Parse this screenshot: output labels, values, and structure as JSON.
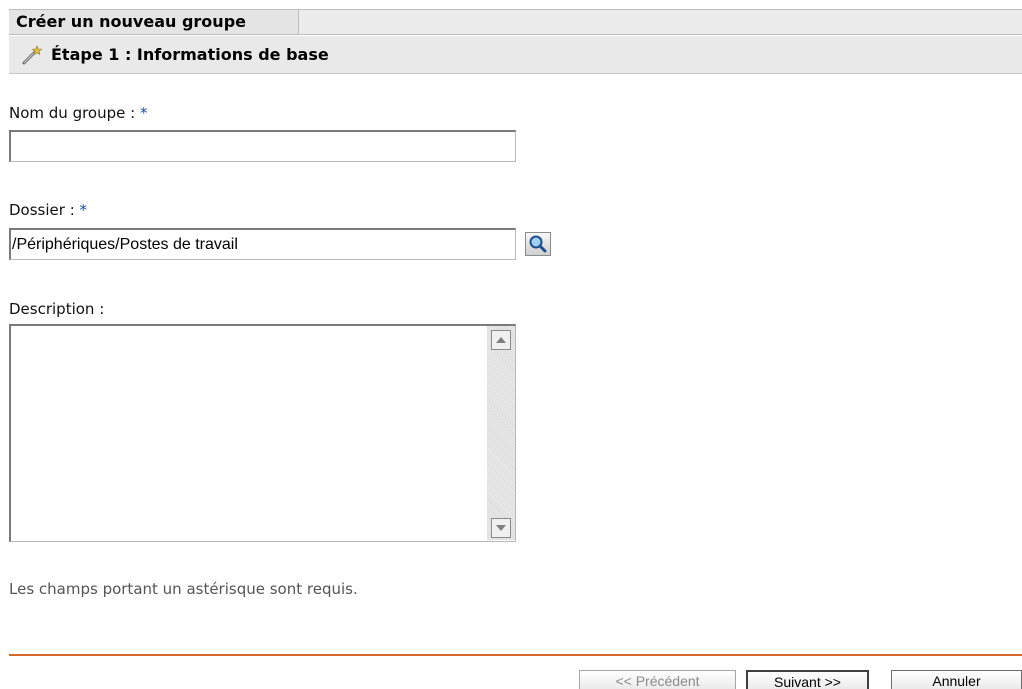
{
  "wizard": {
    "title": "Créer un nouveau groupe",
    "step_title": "Étape 1 : Informations de base",
    "step_icon": "wand-icon"
  },
  "fields": {
    "group_name": {
      "label": "Nom du groupe : ",
      "required_mark": "*",
      "value": ""
    },
    "folder": {
      "label": "Dossier : ",
      "required_mark": "*",
      "value": "/Périphériques/Postes de travail",
      "browse_icon": "magnifier-icon"
    },
    "description": {
      "label": "Description :",
      "value": ""
    }
  },
  "required_note": "Les champs portant un astérisque sont requis.",
  "buttons": {
    "previous": "<< Précédent",
    "next": "Suivant >>",
    "cancel": "Annuler"
  },
  "colors": {
    "divider": "#d2692a",
    "required_asterisk": "#1a4fa0"
  }
}
